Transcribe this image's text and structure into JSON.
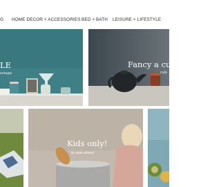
{
  "nav": {
    "items": [
      {
        "label": "G"
      },
      {
        "label": "HOME DECOR + ACCESSORIES"
      },
      {
        "label": "BED + BATH"
      },
      {
        "label": "LEISURE + LIFESTYLE"
      }
    ]
  },
  "tiles": {
    "kitchen": {
      "title": "LE",
      "subtitle": "verhages"
    },
    "cup": {
      "title": "Fancy a cup",
      "subtitle": "Coffe"
    },
    "kids": {
      "title": "Kids only!",
      "subtitle": "No adults allowed"
    }
  },
  "colors": {
    "kitchen_bg": "#3f7f86",
    "cup_bg": "#55616a",
    "kids_bg": "#c4b9ae",
    "outdoor_bg": "#9aa37a",
    "fruit_bg": "#7ea8b3",
    "nav_text": "#2d2d2d"
  }
}
